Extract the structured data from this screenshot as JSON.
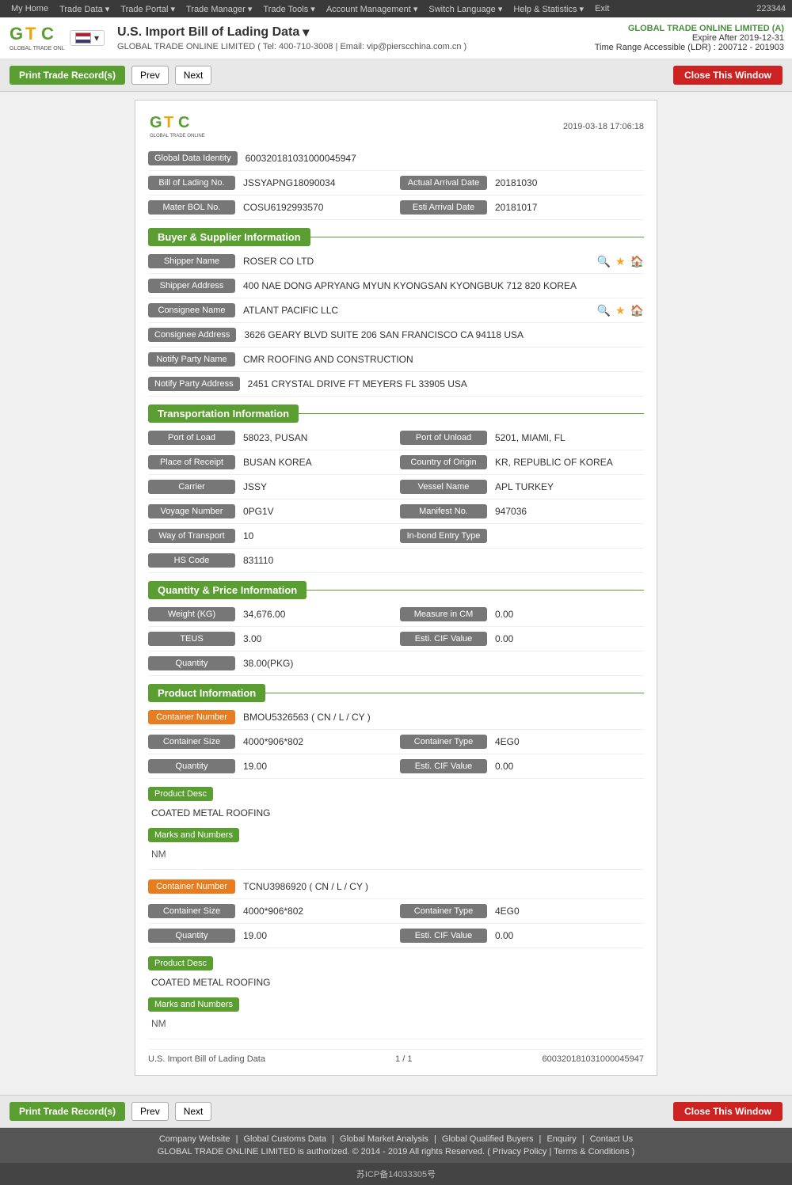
{
  "topnav": {
    "items": [
      "My Home",
      "Trade Data",
      "Trade Portal",
      "Trade Manager",
      "Trade Tools",
      "Account Management",
      "Switch Language",
      "Help & Statistics",
      "Exit"
    ],
    "user_id": "223344"
  },
  "header": {
    "title": "U.S. Import Bill of Lading Data",
    "subtitle": "GLOBAL TRADE ONLINE LIMITED ( Tel: 400-710-3008  |  Email: vip@pierscchina.com.cn )",
    "company": "GLOBAL TRADE ONLINE LIMITED (A)",
    "expire": "Expire After 2019-12-31",
    "time_range": "Time Range Accessible (LDR) : 200712 - 201903"
  },
  "toolbar": {
    "print_label": "Print Trade Record(s)",
    "prev_label": "Prev",
    "next_label": "Next",
    "close_label": "Close This Window"
  },
  "record": {
    "date": "2019-03-18 17:06:18",
    "global_data_identity_label": "Global Data Identity",
    "global_data_identity_value": "600320181031000045947",
    "bol_no_label": "Bill of Lading No.",
    "bol_no_value": "JSSYAPNG18090034",
    "actual_arrival_label": "Actual Arrival Date",
    "actual_arrival_value": "20181030",
    "mater_bol_label": "Mater BOL No.",
    "mater_bol_value": "COSU6192993570",
    "esti_arrival_label": "Esti Arrival Date",
    "esti_arrival_value": "20181017"
  },
  "buyer_supplier": {
    "section_title": "Buyer & Supplier Information",
    "shipper_name_label": "Shipper Name",
    "shipper_name_value": "ROSER CO LTD",
    "shipper_address_label": "Shipper Address",
    "shipper_address_value": "400 NAE DONG APRYANG MYUN KYONGSAN KYONGBUK 712 820 KOREA",
    "consignee_name_label": "Consignee Name",
    "consignee_name_value": "ATLANT PACIFIC LLC",
    "consignee_address_label": "Consignee Address",
    "consignee_address_value": "3626 GEARY BLVD SUITE 206 SAN FRANCISCO CA 94118 USA",
    "notify_party_name_label": "Notify Party Name",
    "notify_party_name_value": "CMR ROOFING AND CONSTRUCTION",
    "notify_party_address_label": "Notify Party Address",
    "notify_party_address_value": "2451 CRYSTAL DRIVE FT MEYERS FL 33905 USA"
  },
  "transportation": {
    "section_title": "Transportation Information",
    "port_of_load_label": "Port of Load",
    "port_of_load_value": "58023, PUSAN",
    "port_of_unload_label": "Port of Unload",
    "port_of_unload_value": "5201, MIAMI, FL",
    "place_of_receipt_label": "Place of Receipt",
    "place_of_receipt_value": "BUSAN KOREA",
    "country_of_origin_label": "Country of Origin",
    "country_of_origin_value": "KR, REPUBLIC OF KOREA",
    "carrier_label": "Carrier",
    "carrier_value": "JSSY",
    "vessel_name_label": "Vessel Name",
    "vessel_name_value": "APL TURKEY",
    "voyage_number_label": "Voyage Number",
    "voyage_number_value": "0PG1V",
    "manifest_no_label": "Manifest No.",
    "manifest_no_value": "947036",
    "way_of_transport_label": "Way of Transport",
    "way_of_transport_value": "10",
    "inbond_entry_label": "In-bond Entry Type",
    "inbond_entry_value": "",
    "hs_code_label": "HS Code",
    "hs_code_value": "831110"
  },
  "quantity_price": {
    "section_title": "Quantity & Price Information",
    "weight_label": "Weight (KG)",
    "weight_value": "34,676.00",
    "measure_label": "Measure in CM",
    "measure_value": "0.00",
    "teus_label": "TEUS",
    "teus_value": "3.00",
    "esti_cif_label": "Esti. CIF Value",
    "esti_cif_value": "0.00",
    "quantity_label": "Quantity",
    "quantity_value": "38.00(PKG)"
  },
  "product_information": {
    "section_title": "Product Information",
    "containers": [
      {
        "container_number_label": "Container Number",
        "container_number_value": "BMOU5326563 ( CN / L / CY )",
        "container_size_label": "Container Size",
        "container_size_value": "4000*906*802",
        "container_type_label": "Container Type",
        "container_type_value": "4EG0",
        "quantity_label": "Quantity",
        "quantity_value": "19.00",
        "esti_cif_label": "Esti. CIF Value",
        "esti_cif_value": "0.00",
        "product_desc_label": "Product Desc",
        "product_desc_value": "COATED METAL ROOFING",
        "marks_label": "Marks and Numbers",
        "marks_value": "NM"
      },
      {
        "container_number_label": "Container Number",
        "container_number_value": "TCNU3986920 ( CN / L / CY )",
        "container_size_label": "Container Size",
        "container_size_value": "4000*906*802",
        "container_type_label": "Container Type",
        "container_type_value": "4EG0",
        "quantity_label": "Quantity",
        "quantity_value": "19.00",
        "esti_cif_label": "Esti. CIF Value",
        "esti_cif_value": "0.00",
        "product_desc_label": "Product Desc",
        "product_desc_value": "COATED METAL ROOFING",
        "marks_label": "Marks and Numbers",
        "marks_value": "NM"
      }
    ]
  },
  "record_footer": {
    "left": "U.S. Import Bill of Lading Data",
    "center": "1 / 1",
    "right": "600320181031000045947"
  },
  "footer": {
    "links": [
      "Company Website",
      "Global Customs Data",
      "Global Market Analysis",
      "Global Qualified Buyers",
      "Enquiry",
      "Contact Us"
    ],
    "copyright": "GLOBAL TRADE ONLINE LIMITED is authorized. © 2014 - 2019 All rights Reserved. ( Privacy Policy | Terms & Conditions )",
    "icp": "苏ICP备14033305号"
  }
}
